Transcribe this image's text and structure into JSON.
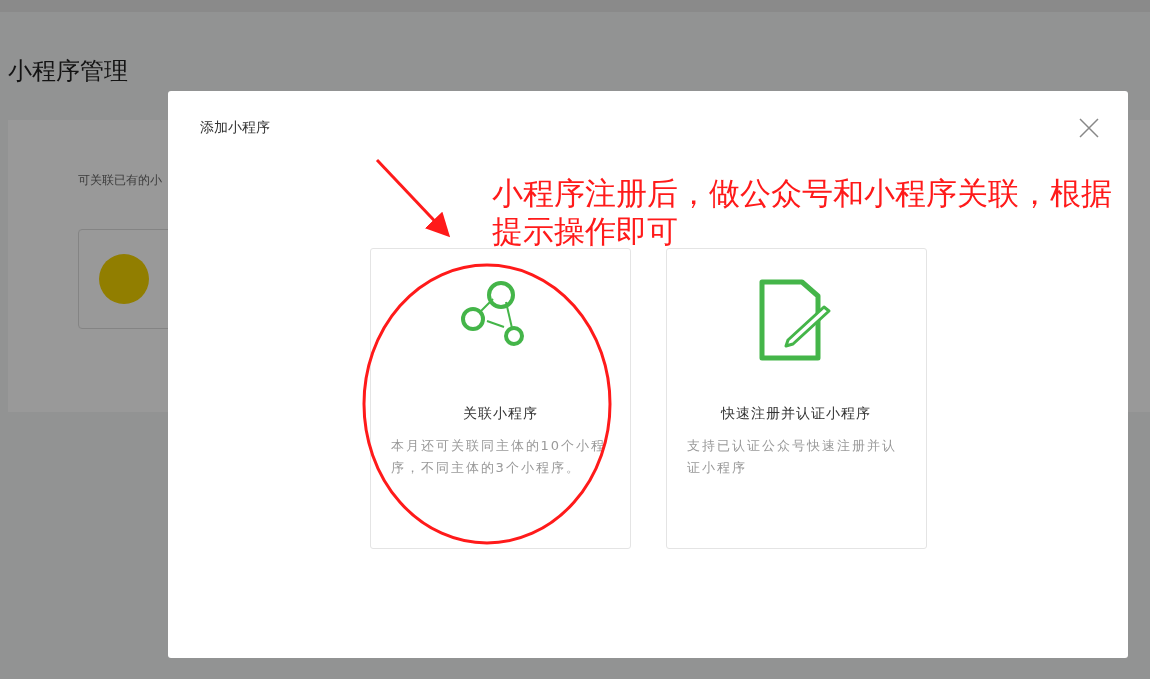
{
  "page": {
    "title": "小程序管理",
    "hint": "可关联已有的小"
  },
  "dialog": {
    "title": "添加小程序",
    "options": [
      {
        "kind": "link",
        "title": "关联小程序",
        "description": "本月还可关联同主体的10个小程序，不同主体的3个小程序。"
      },
      {
        "kind": "register",
        "title": "快速注册并认证小程序",
        "description": "支持已认证公众号快速注册并认证小程序"
      }
    ]
  },
  "annotation": {
    "text": "小程序注册后，做公众号和小程序关联，根据提示操作即可"
  }
}
